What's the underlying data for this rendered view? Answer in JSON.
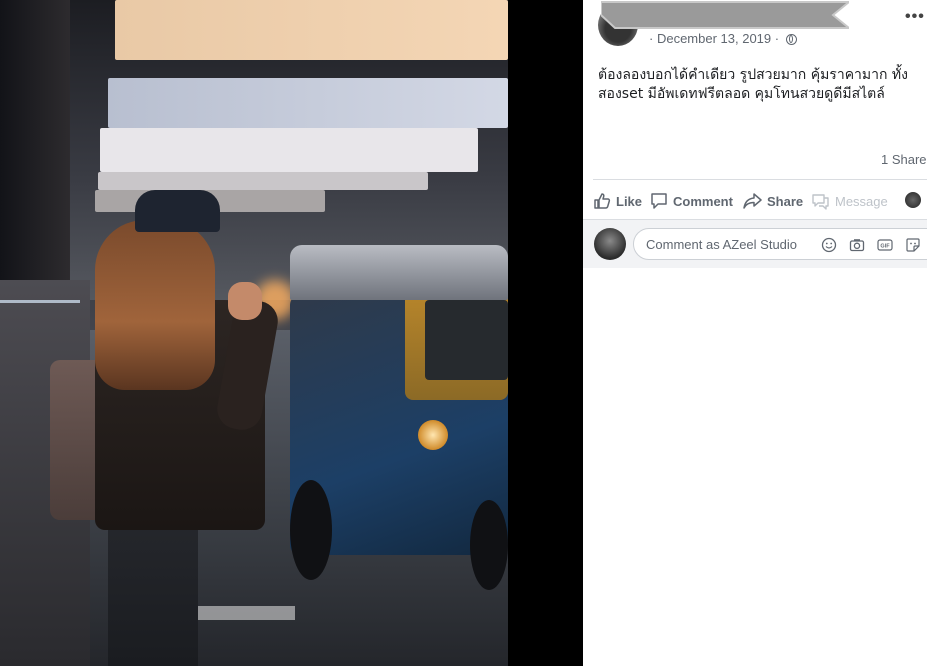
{
  "post": {
    "date": "December 13, 2019",
    "text": "ต้องลองบอกได้คำเดียว รูปสวยมาก คุ้มราคามาก ทั้งสองset มีอัพเดทฟรีตลอด คุมโทนสวยดูดีมีสไตล์",
    "shares": "1 Share"
  },
  "actions": {
    "like": "Like",
    "comment": "Comment",
    "share": "Share",
    "message": "Message"
  },
  "comment_input": {
    "placeholder": "Comment as AZeel Studio"
  },
  "icons": {
    "more": "more-options-icon",
    "privacy": "globe-icon",
    "like": "thumbs-up-icon",
    "comment": "speech-bubble-icon",
    "share": "share-arrow-icon",
    "message": "messenger-icon",
    "emoji": "smiley-icon",
    "camera": "camera-icon",
    "gif": "gif-icon",
    "sticker": "sticker-icon"
  },
  "colors": {
    "secondary_text": "#606770",
    "disabled_text": "#bec3c9",
    "divider": "#dadde1",
    "comment_bar": "#f2f3f5"
  }
}
